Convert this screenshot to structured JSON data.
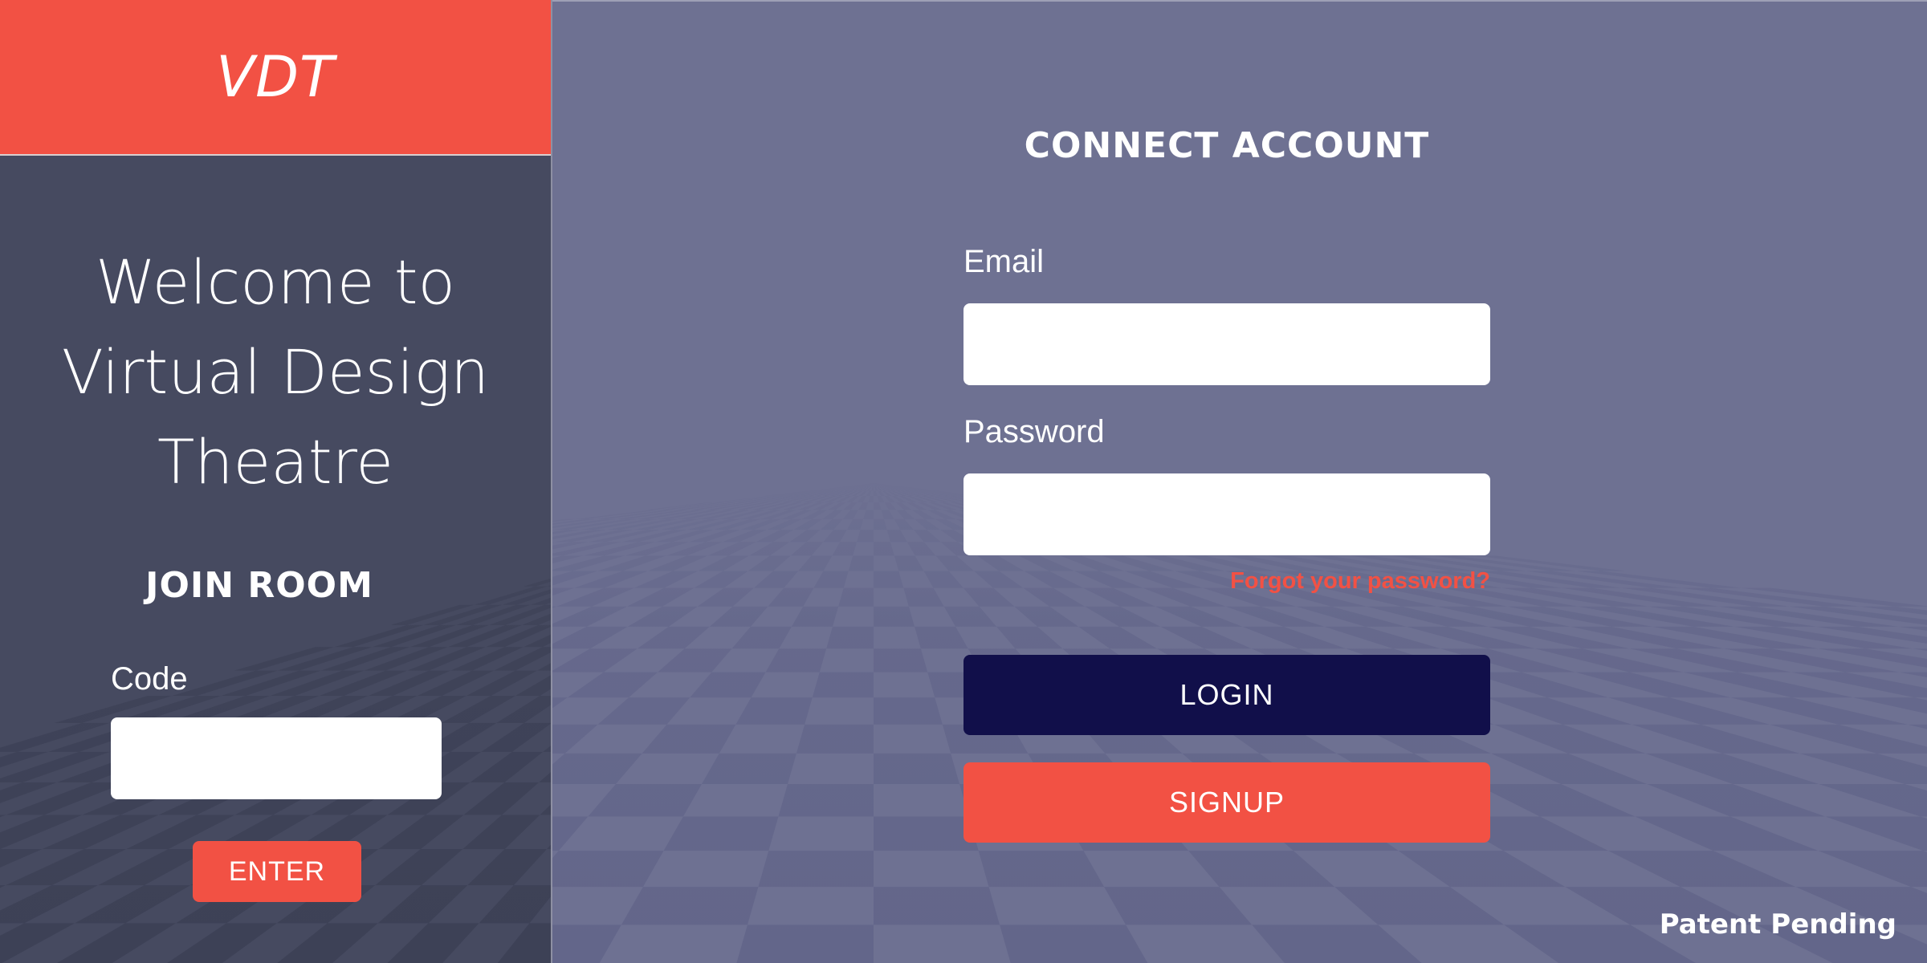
{
  "brand": {
    "logo_text": "VDT",
    "accent_color": "#f25144"
  },
  "join_panel": {
    "welcome_title": "Welcome to\nVirtual Design\nTheatre",
    "heading": "JOIN ROOM",
    "code_label": "Code",
    "code_value": "",
    "enter_label": "ENTER"
  },
  "login_panel": {
    "heading": "CONNECT ACCOUNT",
    "email_label": "Email",
    "email_value": "",
    "password_label": "Password",
    "password_value": "",
    "forgot_password": "Forgot your password?",
    "login_label": "LOGIN",
    "signup_label": "SIGNUP"
  },
  "footer": {
    "patent_note": "Patent Pending"
  },
  "colors": {
    "left_panel_bg": "#464a60",
    "right_panel_bg": "#6e7192",
    "login_button": "#110f4a",
    "signup_button": "#f25144",
    "link": "#f25144"
  }
}
